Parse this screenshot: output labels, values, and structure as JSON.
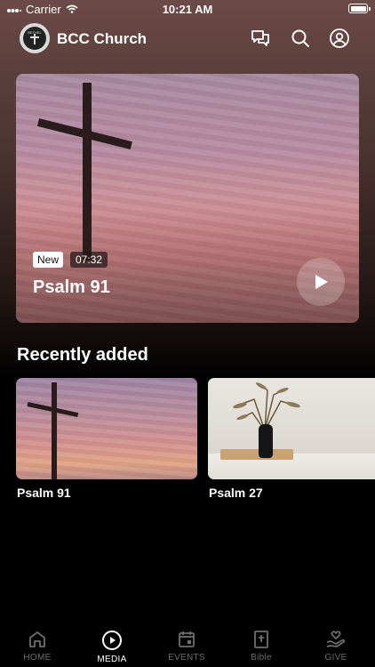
{
  "status_bar": {
    "carrier": "Carrier",
    "time": "10:21 AM"
  },
  "header": {
    "title": "BCC Church",
    "logo_text": "BETHEL"
  },
  "featured": {
    "badge": "New",
    "duration": "07:32",
    "title": "Psalm 91"
  },
  "recently_added": {
    "heading": "Recently added",
    "items": [
      {
        "title": "Psalm 91"
      },
      {
        "title": "Psalm 27"
      }
    ]
  },
  "tabs": [
    {
      "label": "HOME",
      "icon": "home-icon",
      "active": false
    },
    {
      "label": "MEDIA",
      "icon": "play-circle-icon",
      "active": true
    },
    {
      "label": "EVENTS",
      "icon": "calendar-icon",
      "active": false
    },
    {
      "label": "Bible",
      "icon": "bible-icon",
      "active": false
    },
    {
      "label": "GIVE",
      "icon": "give-heart-hand-icon",
      "active": false
    }
  ],
  "colors": {
    "background": "#000000",
    "header_gradient_top": "#6b4a47",
    "tab_inactive": "#6e6e6e",
    "tab_active": "#ffffff"
  }
}
